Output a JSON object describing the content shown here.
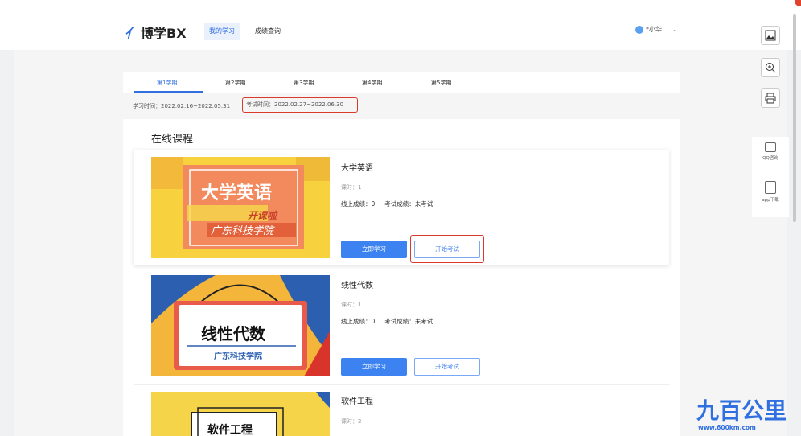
{
  "app": {
    "logo_text": "博学BX"
  },
  "nav": {
    "items": [
      {
        "label": "我的学习"
      },
      {
        "label": "成绩查询"
      }
    ]
  },
  "user": {
    "name": "*小华"
  },
  "semesters": {
    "tabs": [
      "第1学期",
      "第2学期",
      "第3学期",
      "第4学期",
      "第5学期"
    ],
    "active_index": 0
  },
  "times": {
    "study": "学习时间：2022.02.16~2022.05.31",
    "exam": "考试时间：2022.02.27~2022.06.30"
  },
  "section": {
    "title": "在线课程"
  },
  "courses": [
    {
      "title": "大学英语",
      "hours": "课时：1",
      "online_score": "线上成绩：0",
      "exam_score": "考试成绩：未考试",
      "study_label": "立即学习",
      "exam_label": "开始考试",
      "thumb_main": "大学英语",
      "thumb_sub": "开课啦",
      "thumb_school": "广东科技学院"
    },
    {
      "title": "线性代数",
      "hours": "课时：1",
      "online_score": "线上成绩：0",
      "exam_score": "考试成绩：未考试",
      "study_label": "立即学习",
      "exam_label": "开始考试",
      "thumb_main": "线性代数",
      "thumb_school": "广东科技学院"
    },
    {
      "title": "软件工程",
      "hours": "课时：2",
      "thumb_main": "软件工程"
    }
  ],
  "side_tools": {
    "qq_label": "QQ咨询",
    "app_label": "app下载"
  },
  "colors": {
    "accent": "#2f6fe0",
    "highlight": "#d93a2c",
    "button": "#3c82f0"
  },
  "corner_watermark": {
    "text": "www.600km.com",
    "brand": "九百公里"
  }
}
